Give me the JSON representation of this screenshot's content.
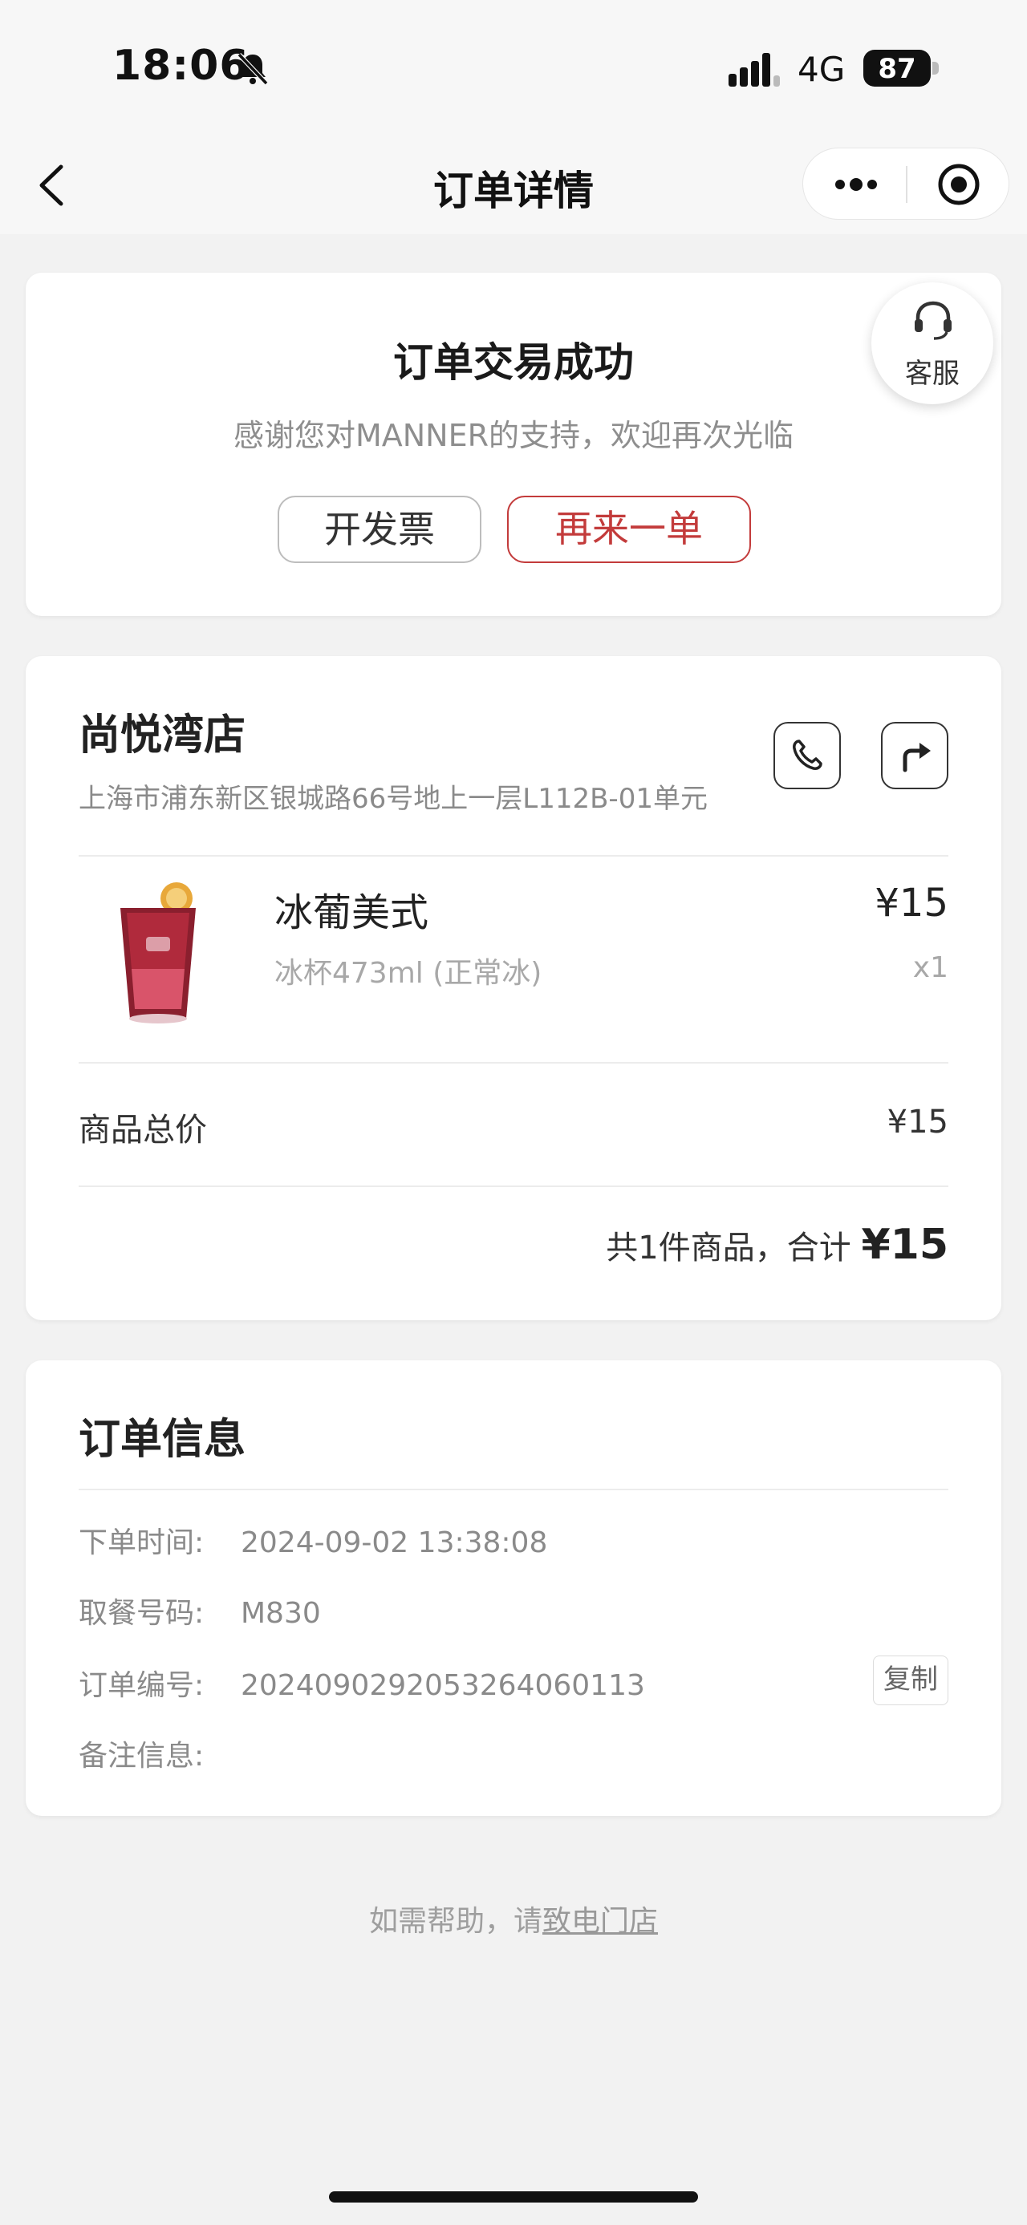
{
  "status_bar": {
    "time": "18:06",
    "network": "4G",
    "battery": "87",
    "icons": [
      "bell-muted-icon",
      "signal-icon",
      "battery-icon"
    ]
  },
  "nav": {
    "title": "订单详情",
    "icons": [
      "back-chevron-icon",
      "more-dots-icon",
      "record-target-icon"
    ]
  },
  "status_card": {
    "title": "订单交易成功",
    "subtitle": "感谢您对MANNER的支持，欢迎再次光临",
    "invoice_button": "开发票",
    "reorder_button": "再来一单",
    "customer_service_label": "客服",
    "customer_service_icon": "headset-icon"
  },
  "store_card": {
    "store_name": "尚悦湾店",
    "address": "上海市浦东新区银城路66号地上一层L112B-01单元",
    "icons": [
      "phone-icon",
      "navigate-icon"
    ],
    "product": {
      "name": "冰葡美式",
      "spec": "冰杯473ml (正常冰)",
      "price": "¥15",
      "quantity": "x1",
      "image_icon": "iced-drink-icon"
    },
    "total_label": "商品总价",
    "total_value": "¥15",
    "summary_prefix": "共1件商品，合计",
    "summary_amount": "¥15"
  },
  "order_info": {
    "title": "订单信息",
    "rows": [
      {
        "label": "下单时间:",
        "value": "2024-09-02 13:38:08"
      },
      {
        "label": "取餐号码:",
        "value": "M830"
      },
      {
        "label": "订单编号:",
        "value": "20240902920532640601​13"
      },
      {
        "label": "备注信息:",
        "value": ""
      }
    ],
    "copy_button": "复制"
  },
  "help": {
    "prefix": "如需帮助，请",
    "link": "致电门店"
  },
  "colors": {
    "accent_red": "#c33b3b",
    "background": "#f2f2f2",
    "card": "#ffffff"
  }
}
